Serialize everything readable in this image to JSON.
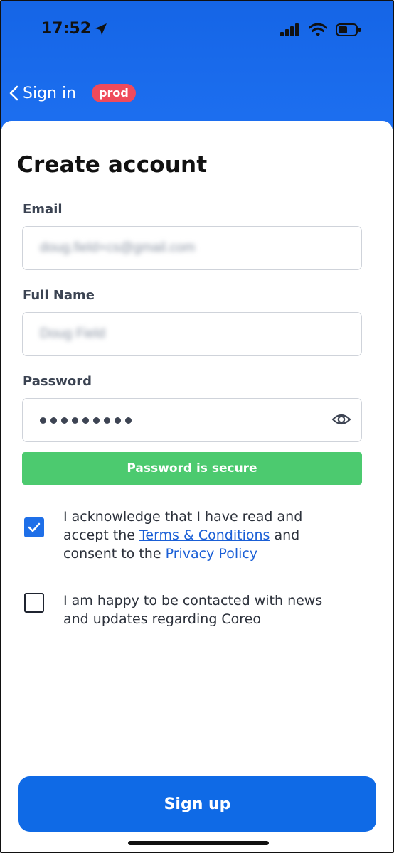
{
  "status_bar": {
    "time": "17:52"
  },
  "nav": {
    "back_label": "Sign in",
    "env_badge": "prod"
  },
  "form": {
    "title": "Create account",
    "email": {
      "label": "Email",
      "value": "doug.field+cs@gmail.com"
    },
    "full_name": {
      "label": "Full Name",
      "value": "Doug Field"
    },
    "password": {
      "label": "Password",
      "masked_length": 9,
      "strength_message": "Password is secure"
    },
    "terms": {
      "checked": true,
      "text_1": "I acknowledge that I have read and accept the ",
      "terms_link": "Terms & Conditions",
      "text_2": " and consent to the ",
      "privacy_link": "Privacy Policy"
    },
    "marketing": {
      "checked": false,
      "text": "I am happy to be contacted with news and updates regarding Coreo"
    },
    "submit_label": "Sign up"
  },
  "colors": {
    "header_blue": "#1565e6",
    "badge_red": "#ef4a5b",
    "success_green": "#4cca6f",
    "primary_button": "#0f6ae6",
    "link_blue": "#1a5fd6"
  }
}
